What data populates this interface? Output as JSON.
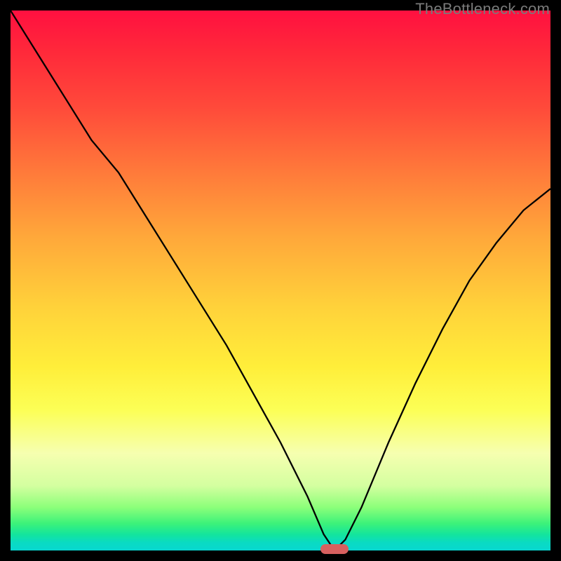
{
  "watermark": "TheBottleneck.com",
  "chart_data": {
    "type": "line",
    "title": "",
    "xlabel": "",
    "ylabel": "",
    "xlim": [
      0,
      100
    ],
    "ylim": [
      0,
      100
    ],
    "x": [
      0,
      5,
      10,
      15,
      20,
      25,
      30,
      35,
      40,
      45,
      50,
      55,
      58,
      60,
      62,
      65,
      70,
      75,
      80,
      85,
      90,
      95,
      100
    ],
    "values": [
      100,
      92,
      84,
      76,
      70,
      62,
      54,
      46,
      38,
      29,
      20,
      10,
      3,
      0,
      2,
      8,
      20,
      31,
      41,
      50,
      57,
      63,
      67
    ],
    "marker": {
      "x": 60,
      "y": 0
    },
    "background_gradient": {
      "top": "#ff1040",
      "mid": "#ffee3a",
      "bottom": "#08d7d0"
    }
  },
  "marker_color": "#d7605f"
}
